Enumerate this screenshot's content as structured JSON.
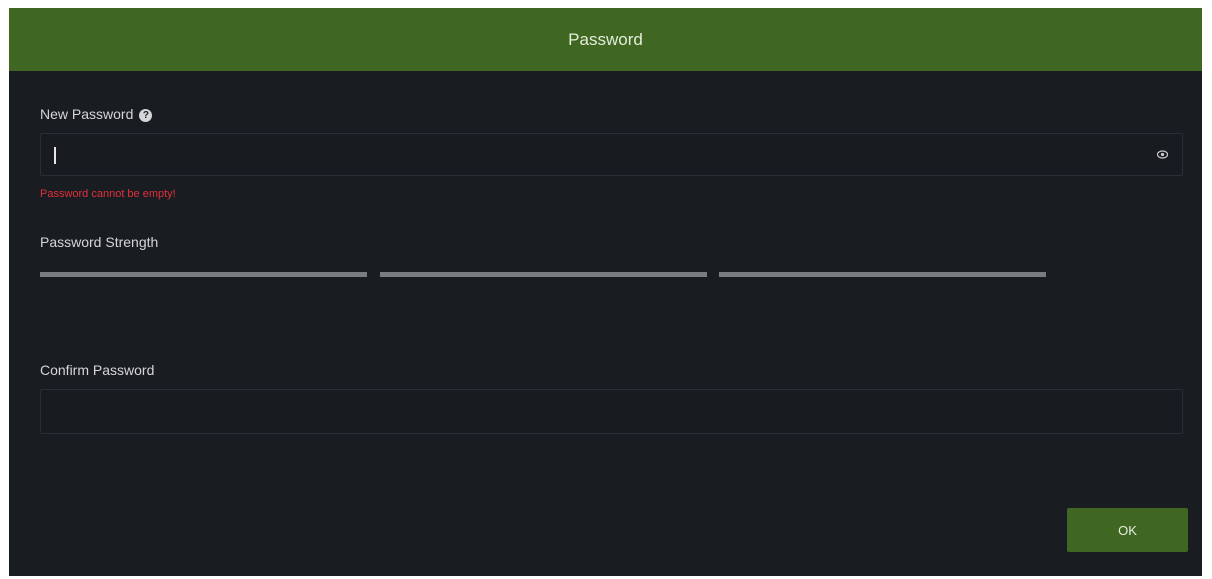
{
  "dialog": {
    "title": "Password"
  },
  "new_password": {
    "label": "New Password",
    "value": "",
    "error": "Password cannot be empty!"
  },
  "strength": {
    "label": "Password Strength",
    "level": 0,
    "segments": 3
  },
  "confirm_password": {
    "label": "Confirm Password",
    "value": ""
  },
  "footer": {
    "ok_label": "OK"
  },
  "icons": {
    "help": "question-circle-icon",
    "visibility": "eye-icon"
  },
  "colors": {
    "accent": "#3f6721",
    "background": "#191c20",
    "error": "#e0303a",
    "strength_empty": "#7a7d80"
  }
}
